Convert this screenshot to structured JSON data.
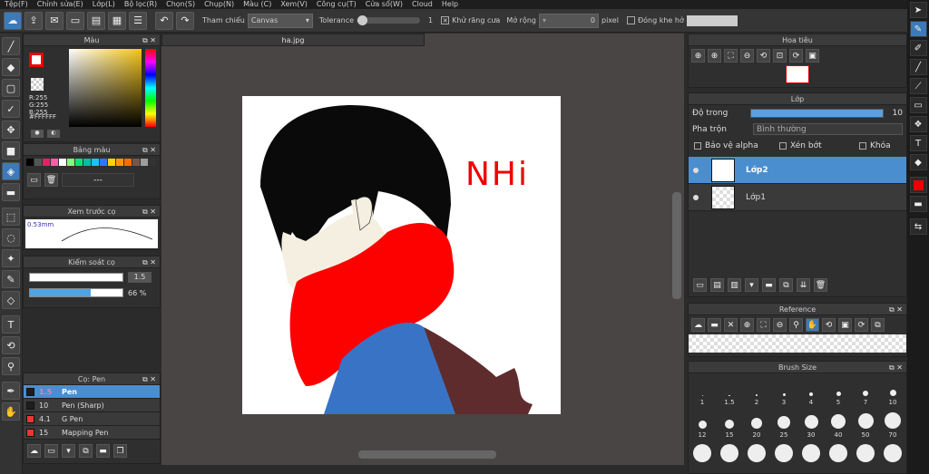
{
  "menu": [
    "Tệp(F)",
    "Chỉnh sửa(E)",
    "Lớp(L)",
    "Bộ lọc(R)",
    "Chọn(S)",
    "Chụp(N)",
    "Màu (C)",
    "Xem(V)",
    "Công cụ(T)",
    "Cửa sổ(W)",
    "Cloud",
    "Help"
  ],
  "toolbar": {
    "tham_chieu_label": "Tham chiếu",
    "tham_chieu_value": "Canvas",
    "tolerance_label": "Tolerance",
    "tolerance_value": "1",
    "tolerance_level": 0.02,
    "antialias_label": "Khử răng cưa",
    "expand_label": "Mở rộng",
    "expand_value": "0",
    "pixel_label": "pixel",
    "gap_label": "Đóng khe hở"
  },
  "color_panel": {
    "title": "Màu",
    "r": "R:255",
    "g": "G:255",
    "b": "B:255",
    "hex": "#FFFFFF"
  },
  "palette": {
    "title": "Bảng màu",
    "colors": [
      "#000000",
      "#555555",
      "#e91e63",
      "#ff5ea8",
      "#ffffff",
      "#7fff7f",
      "#00e676",
      "#00bfa5",
      "#18c6ff",
      "#2979ff",
      "#ffd600",
      "#ff9800",
      "#ff6d00",
      "#795548",
      "#9e9e9e",
      "#333333"
    ]
  },
  "brush_preview": {
    "title": "Xem trước cọ",
    "size": "0.53mm"
  },
  "brush_control": {
    "title": "Kiểm soát cọ",
    "size_value": "1.5",
    "size_level": 1.0,
    "opacity_value": "66 %",
    "opacity_level": 0.66
  },
  "brush_list": {
    "title": "Cọ: Pen",
    "items": [
      {
        "size": "1.5",
        "name": "Pen",
        "color": "#1e1e1e"
      },
      {
        "size": "10",
        "name": "Pen (Sharp)",
        "color": "#1e1e1e"
      },
      {
        "size": "4.1",
        "name": "G Pen",
        "color": "#e53935"
      },
      {
        "size": "15",
        "name": "Mapping Pen",
        "color": "#e53935"
      }
    ]
  },
  "document": {
    "tab": "ha.jpg",
    "text": "NHi"
  },
  "navigator": {
    "title": "Hoa tiêu"
  },
  "layers": {
    "title": "Lớp",
    "opacity_label": "Độ trong",
    "opacity_value": "10",
    "opacity_level": 1.0,
    "blend_label": "Pha trộn",
    "blend_value": "Bình thường",
    "protect_alpha": "Bảo vệ alpha",
    "clipping": "Xén bớt",
    "lock": "Khóa",
    "items": [
      {
        "name": "Lớp2"
      },
      {
        "name": "Lớp1"
      }
    ]
  },
  "reference": {
    "title": "Reference"
  },
  "brush_size": {
    "title": "Brush Size",
    "row1": [
      "1",
      "1.5",
      "2",
      "3",
      "4",
      "5",
      "7",
      "10"
    ],
    "row2": [
      "12",
      "15",
      "20",
      "25",
      "30",
      "40",
      "50",
      "70"
    ]
  }
}
